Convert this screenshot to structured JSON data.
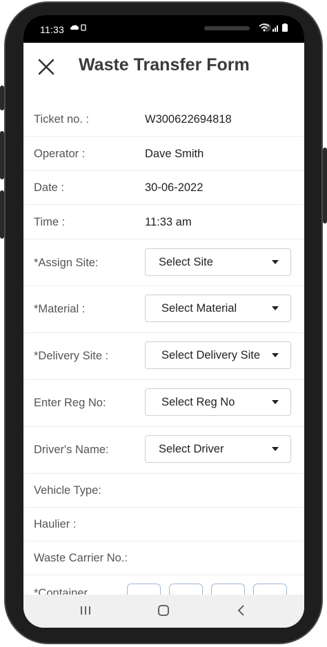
{
  "status_bar": {
    "time": "11:33",
    "left_icons": [
      "cloud-icon",
      "sim-icon"
    ],
    "right_icons": [
      "wifi-icon",
      "signal-icon",
      "battery-icon"
    ]
  },
  "header": {
    "title": "Waste Transfer Form",
    "close_icon": "close-icon"
  },
  "form": {
    "ticket": {
      "label": "Ticket no. :",
      "value": "W300622694818"
    },
    "operator": {
      "label": "Operator :",
      "value": "Dave Smith"
    },
    "date": {
      "label": "Date :",
      "value": "30-06-2022"
    },
    "time": {
      "label": "Time :",
      "value": "11:33 am"
    },
    "assign_site": {
      "label": "*Assign Site:",
      "placeholder": "Select Site"
    },
    "material": {
      "label": "*Material :",
      "placeholder": "Select Material"
    },
    "delivery_site": {
      "label": "*Delivery Site :",
      "placeholder": "Select Delivery Site"
    },
    "reg_no": {
      "label": "Enter Reg No:",
      "placeholder": "Select Reg No"
    },
    "driver": {
      "label": "Driver's Name:",
      "placeholder": "Select Driver"
    },
    "vehicle_type": {
      "label": "Vehicle Type:"
    },
    "haulier": {
      "label": "Haulier :"
    },
    "waste_carrier": {
      "label": "Waste Carrier No.:"
    },
    "container": {
      "label": "*Container",
      "box_count": 4
    }
  },
  "nav_bar": {
    "icons": [
      "recent-apps-icon",
      "home-icon",
      "back-icon"
    ]
  },
  "colors": {
    "phone_frame": "#1e1e1e",
    "title": "#3a3a3a",
    "label": "#555555",
    "divider": "#ececec",
    "container_box_border": "#9fb7d6"
  }
}
